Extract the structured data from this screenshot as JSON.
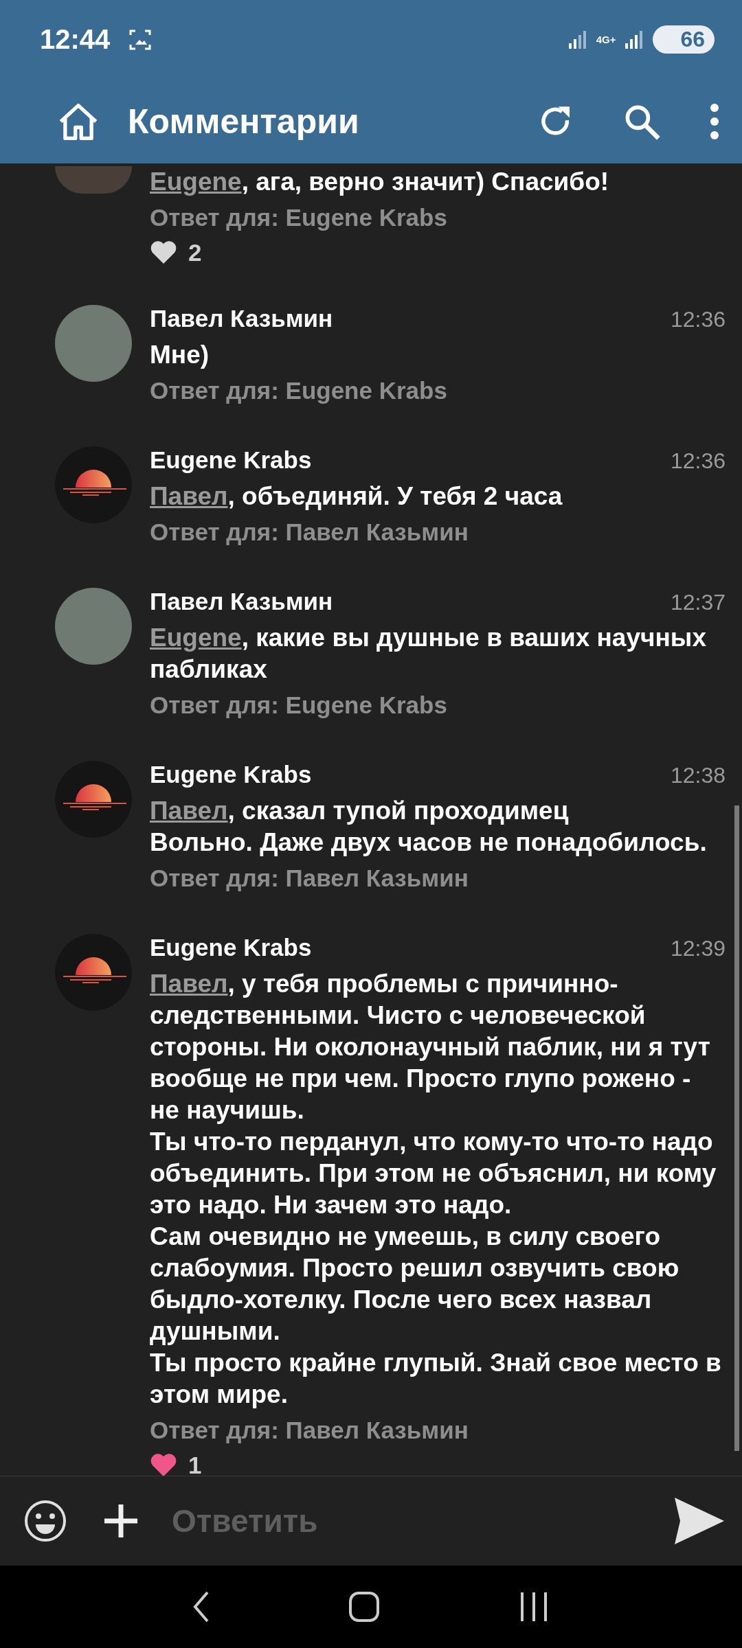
{
  "status_bar": {
    "time": "12:44",
    "network": "4G+",
    "battery": "66"
  },
  "app_bar": {
    "title": "Комментарии"
  },
  "comments": [
    {
      "avatar": {
        "kind": "photo"
      },
      "mention": "Eugene",
      "text": ", ага, верно значит) Спасибо!",
      "reply_to": "Ответ для: Eugene Krabs",
      "likes": {
        "count": "2",
        "liked": false
      }
    },
    {
      "author": "Павел Казьмин",
      "time": "12:36",
      "avatar": {
        "kind": "photo"
      },
      "text": "Мне)",
      "reply_to": "Ответ для: Eugene Krabs"
    },
    {
      "author": "Eugene Krabs",
      "time": "12:36",
      "avatar": {
        "kind": "sunset"
      },
      "mention": "Павел",
      "text": ", объединяй. У тебя 2 часа",
      "reply_to": "Ответ для: Павел Казьмин"
    },
    {
      "author": "Павел Казьмин",
      "time": "12:37",
      "avatar": {
        "kind": "photo"
      },
      "mention": "Eugene",
      "text": ", какие вы душные в ваших научных пабликах",
      "reply_to": "Ответ для: Eugene Krabs"
    },
    {
      "author": "Eugene Krabs",
      "time": "12:38",
      "avatar": {
        "kind": "sunset"
      },
      "mention": "Павел",
      "text": ", сказал тупой проходимец\nВольно. Даже двух часов не понадобилось.",
      "reply_to": "Ответ для: Павел Казьмин"
    },
    {
      "author": "Eugene Krabs",
      "time": "12:39",
      "avatar": {
        "kind": "sunset"
      },
      "mention": "Павел",
      "text": ", у тебя проблемы с причинно-следственными. Чисто с человеческой стороны. Ни околонаучный паблик, ни я тут вообще не при чем. Просто глупо рожено - не научишь.\nТы что-то перданул, что кому-то что-то надо объединить. При этом не объяснил, ни кому это надо. Ни зачем это надо.\nСам очевидно не умеешь, в силу своего слабоумия. Просто решил озвучить свою быдло-хотелку. После чего всех назвал душными.\nТы просто крайне глупый. Знай свое место в этом мире.",
      "reply_to": "Ответ для: Павел Казьмин",
      "likes": {
        "count": "1",
        "liked": true
      }
    }
  ],
  "composer": {
    "placeholder": "Ответить"
  }
}
